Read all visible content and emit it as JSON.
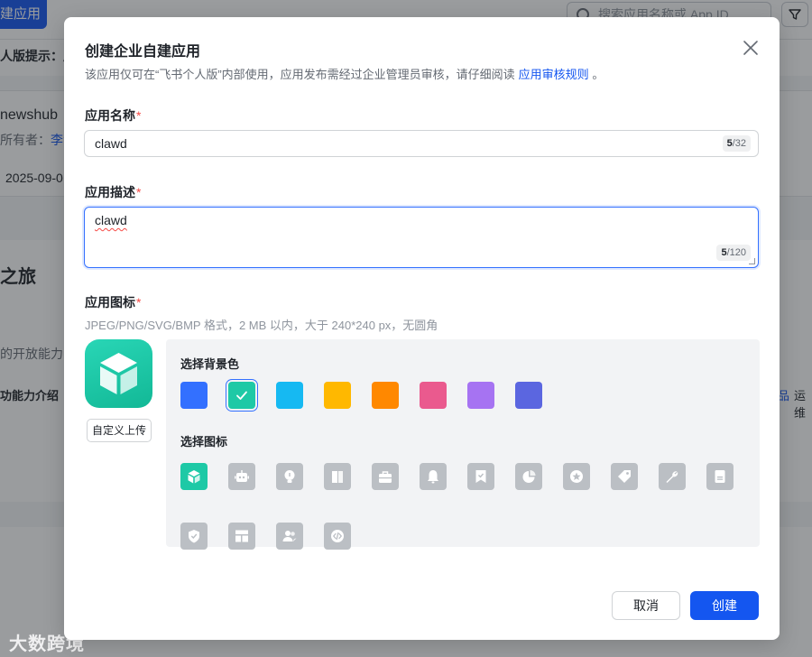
{
  "background": {
    "create_app_label": "建应用",
    "search_placeholder": "搜索应用名称或 App ID",
    "notice_text": "人版提示：应",
    "app_name": "newshub",
    "owner_label": "所有者：",
    "owner_name": "李江",
    "date_text": "2025-09-0",
    "journey_title": "之旅",
    "open_capability_text": "的开放能力，",
    "capability_intro": "功能力介绍",
    "right_link": "品",
    "right_text": "运维"
  },
  "watermark": "大数跨境",
  "modal": {
    "title": "创建企业自建应用",
    "subtitle": "该应用仅可在“飞书个人版”内部使用，应用发布需经过企业管理员审核，请仔细阅读",
    "subtitle_link": "应用审核规则",
    "subtitle_end": "。",
    "name_field": {
      "label": "应用名称",
      "required_mark": "*",
      "value": "clawd",
      "count": "5",
      "max": "/32"
    },
    "desc_field": {
      "label": "应用描述",
      "required_mark": "*",
      "value": "clawd",
      "count": "5",
      "max": "/120"
    },
    "icon_field": {
      "label": "应用图标",
      "required_mark": "*",
      "hint": "JPEG/PNG/SVG/BMP 格式，2 MB 以内，大于 240*240 px，无圆角",
      "upload_label": "自定义上传"
    },
    "picker": {
      "bg_label": "选择背景色",
      "icon_label": "选择图标",
      "colors": [
        "#3370ff",
        "#1ec9a6",
        "#16b9f2",
        "#ffb800",
        "#ff8800",
        "#ea5a8e",
        "#a673f2",
        "#5b66e0"
      ],
      "selected_color_index": 1,
      "icons": [
        "cube-icon",
        "robot-icon",
        "bulb-icon",
        "book-icon",
        "briefcase-icon",
        "bell-icon",
        "bookmark-icon",
        "pie-chart-icon",
        "star-badge-icon",
        "tag-icon",
        "wrench-icon",
        "document-icon",
        "shield-check-icon",
        "layout-icon",
        "people-icon",
        "code-icon"
      ],
      "selected_icon_index": 0
    },
    "cancel_label": "取消",
    "create_label": "创建"
  }
}
